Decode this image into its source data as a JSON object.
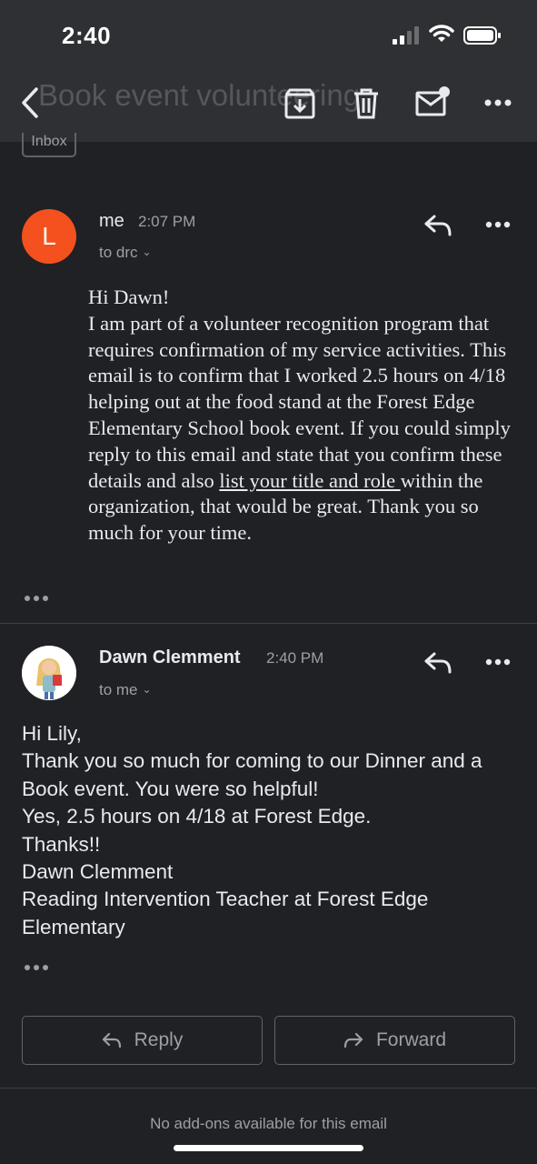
{
  "status": {
    "time": "2:40"
  },
  "header": {
    "subject": "Book event volunteering",
    "label_chip": "Inbox"
  },
  "messages": [
    {
      "avatar_letter": "L",
      "sender": "me",
      "time": "2:07 PM",
      "recipient": "to drc",
      "body": [
        "Hi Dawn!",
        "I am part of a volunteer recognition program that requires confirmation of my service activities. This email is to confirm that I worked 2.5 hours on 4/18 helping out at the food stand at the Forest Edge Elementary School book event. If you could simply reply to this email and state that you confirm these details and also ",
        "list your title and role ",
        "within the organization, that would be great. Thank you so much for your time."
      ]
    },
    {
      "sender": "Dawn Clemment",
      "time": "2:40 PM",
      "recipient": "to me",
      "body": [
        "Hi Lily,",
        "Thank you so much for coming to our Dinner and a Book event. You were so helpful!",
        "Yes, 2.5 hours on 4/18 at Forest Edge.",
        "Thanks!!",
        "Dawn Clemment",
        "Reading Intervention Teacher at Forest Edge Elementary"
      ]
    }
  ],
  "actions": {
    "reply": "Reply",
    "forward": "Forward"
  },
  "footer": {
    "addons_note": "No add-ons available for this email"
  },
  "colors": {
    "background": "#202124",
    "header": "#2f3033",
    "avatar_l": "#f4511e",
    "text": "#e8eaed",
    "muted": "#9aa0a6"
  }
}
